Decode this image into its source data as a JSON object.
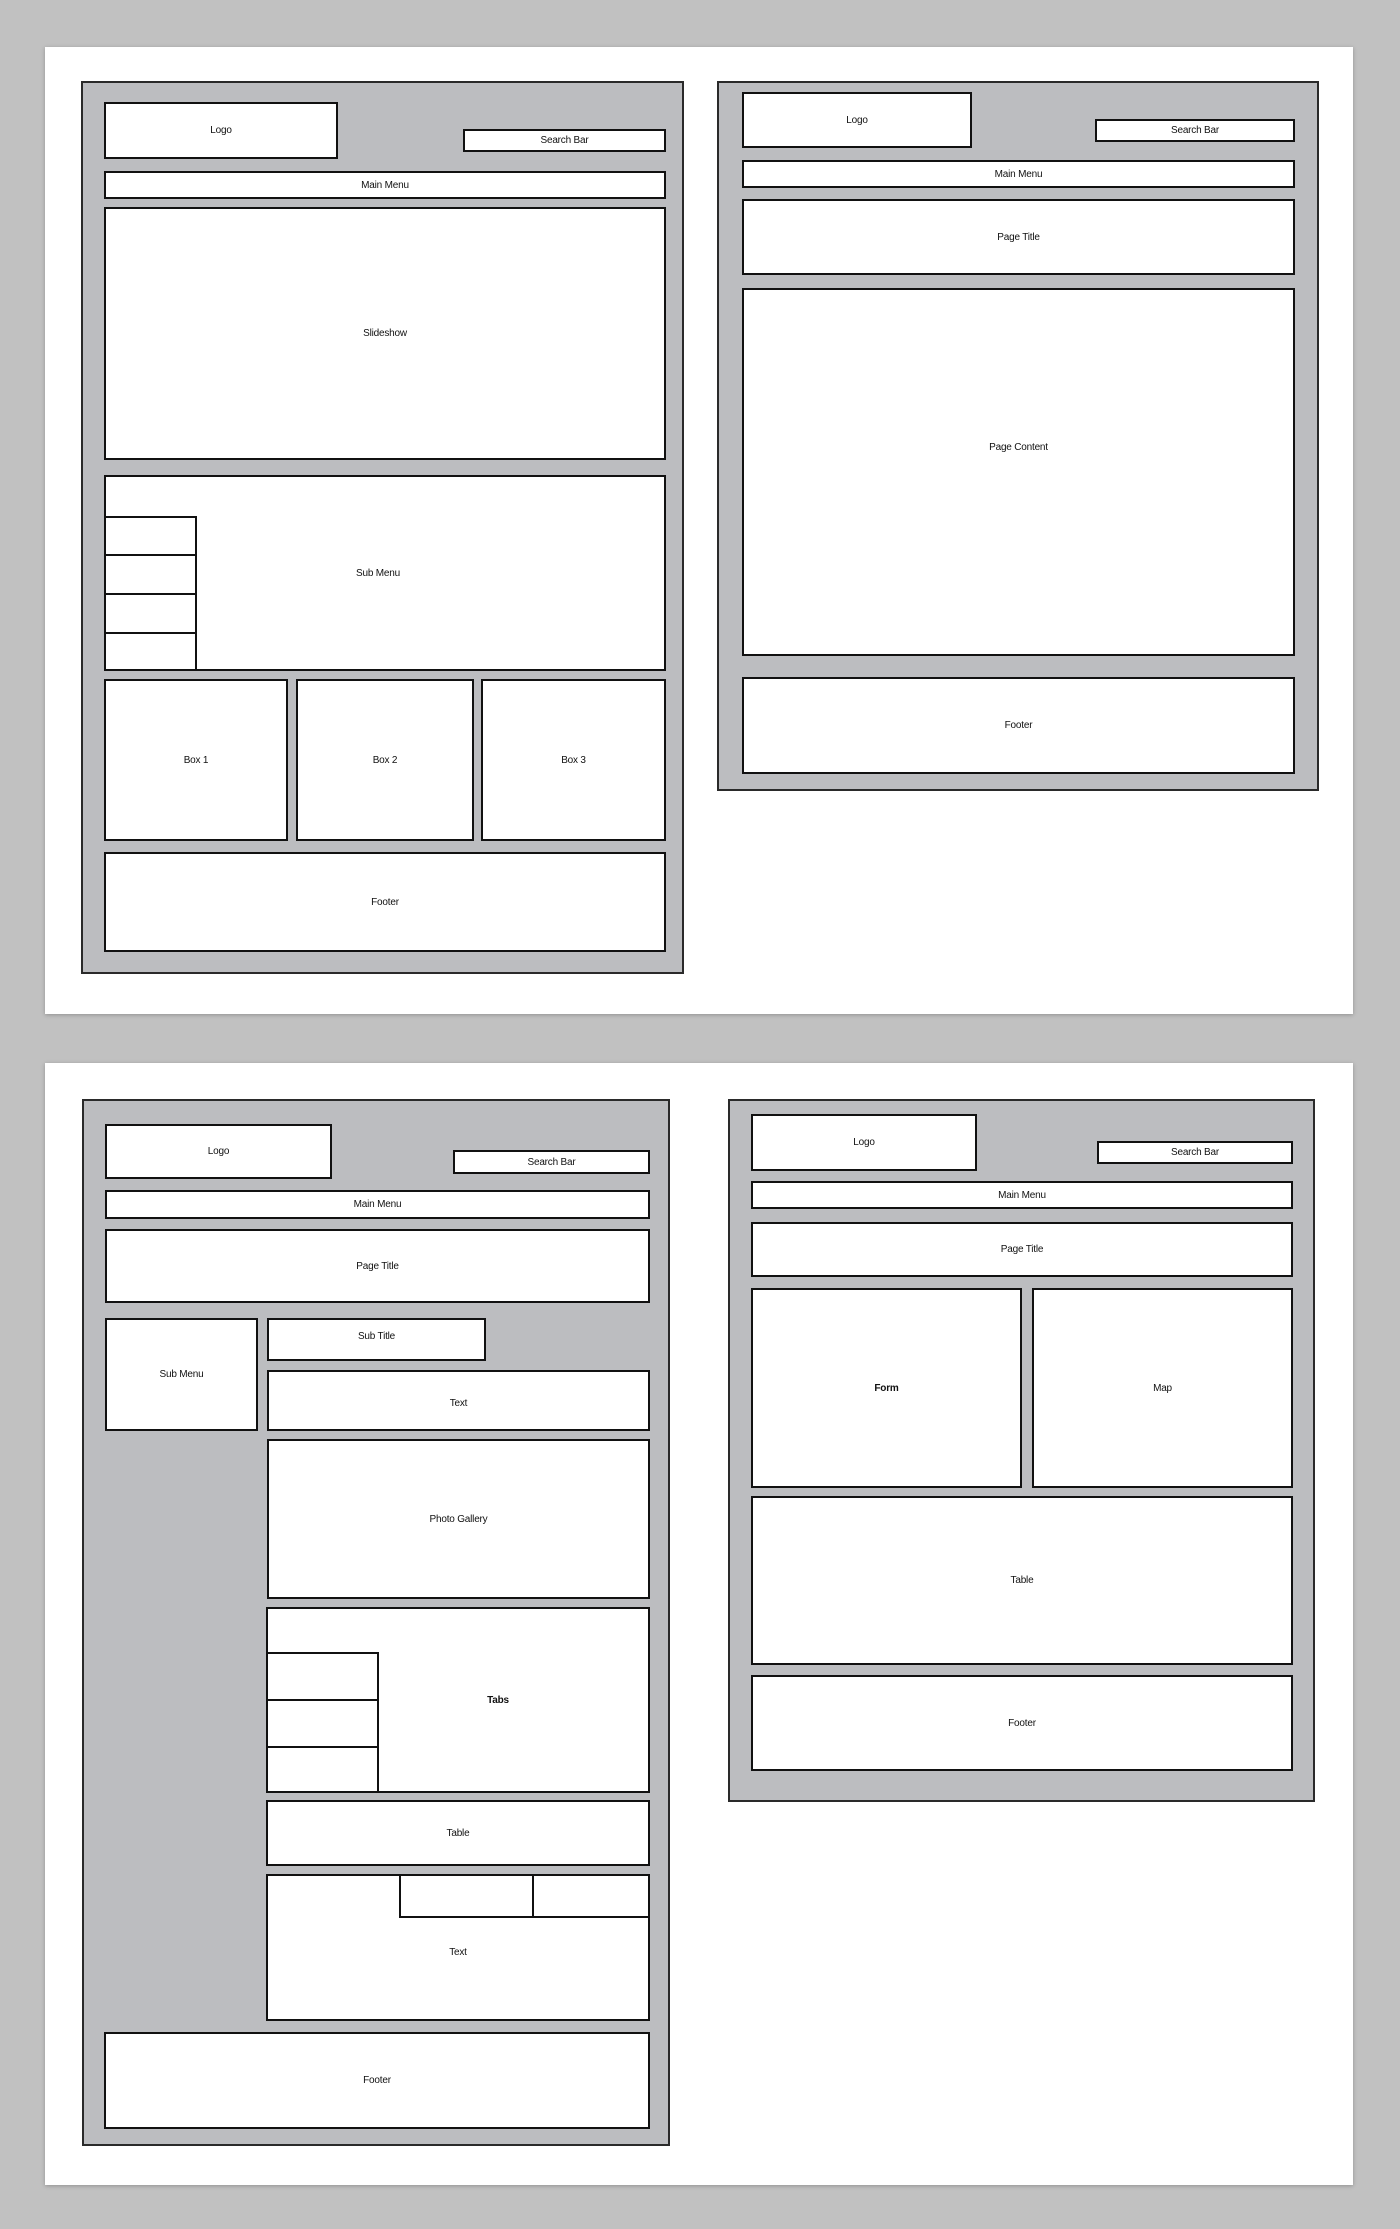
{
  "wireframes": {
    "home": {
      "logo": "Logo",
      "search": "Search Bar",
      "main_menu": "Main Menu",
      "slideshow": "Slideshow",
      "sub_menu": "Sub Menu",
      "boxes": [
        "Box 1",
        "Box 2",
        "Box 3"
      ],
      "footer": "Footer"
    },
    "content_page": {
      "logo": "Logo",
      "search": "Search Bar",
      "main_menu": "Main Menu",
      "page_title": "Page Title",
      "page_content": "Page Content",
      "footer": "Footer"
    },
    "detail_page": {
      "logo": "Logo",
      "search": "Search Bar",
      "main_menu": "Main Menu",
      "page_title": "Page Title",
      "sub_menu": "Sub Menu",
      "sub_title": "Sub Title",
      "text": "Text",
      "photo_gallery": "Photo Gallery",
      "tabs": "Tabs",
      "table": "Table",
      "text2": "Text",
      "footer": "Footer"
    },
    "contact_page": {
      "logo": "Logo",
      "search": "Search Bar",
      "main_menu": "Main Menu",
      "page_title": "Page Title",
      "form": "Form",
      "map": "Map",
      "table": "Table",
      "footer": "Footer"
    }
  },
  "colors": {
    "background": "#c1c1c1",
    "paper": "#ffffff",
    "panel": "#bcbdc0",
    "stroke": "#111111"
  }
}
